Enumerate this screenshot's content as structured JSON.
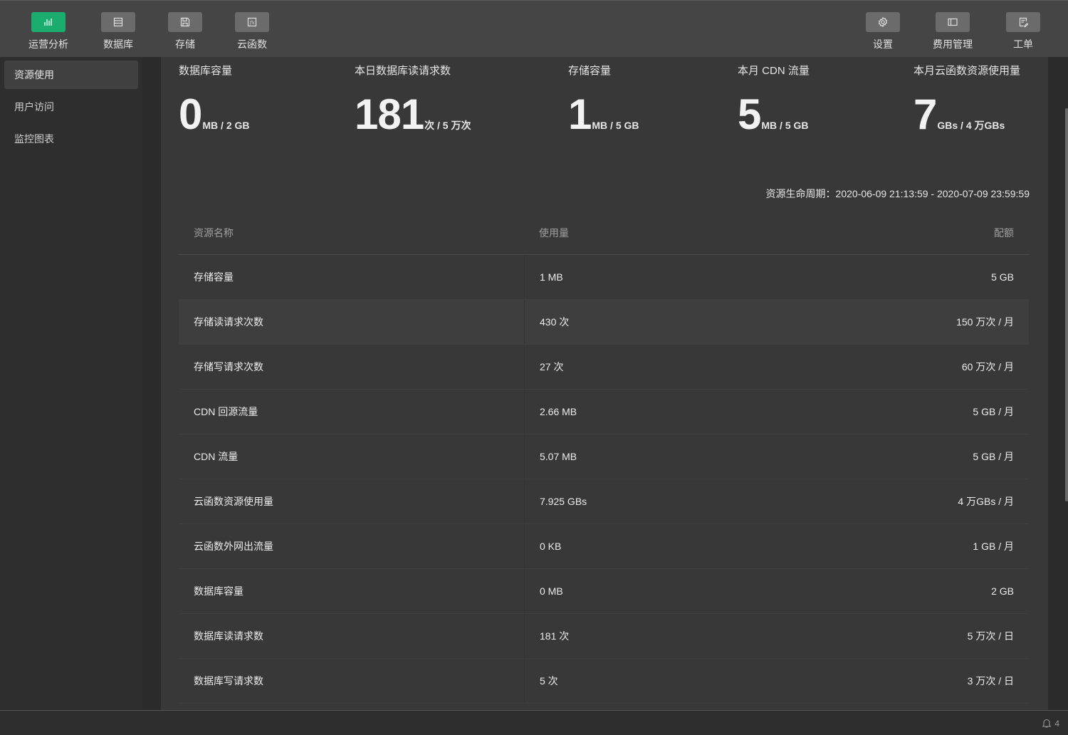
{
  "toolbar": {
    "left": [
      {
        "label": "运营分析",
        "icon": "chart-bars-icon",
        "active": true
      },
      {
        "label": "数据库",
        "icon": "database-icon",
        "active": false
      },
      {
        "label": "存储",
        "icon": "floppy-disk-icon",
        "active": false
      },
      {
        "label": "云函数",
        "icon": "function-fx-icon",
        "active": false
      }
    ],
    "right": [
      {
        "label": "设置",
        "icon": "gear-icon"
      },
      {
        "label": "费用管理",
        "icon": "billing-card-icon"
      },
      {
        "label": "工单",
        "icon": "ticket-edit-icon"
      }
    ],
    "active_color": "#1aad6d"
  },
  "sidebar": {
    "items": [
      {
        "label": "资源使用",
        "active": true
      },
      {
        "label": "用户访问",
        "active": false
      },
      {
        "label": "监控图表",
        "active": false
      }
    ]
  },
  "stats": [
    {
      "title": "数据库容量",
      "value": "0",
      "unit": "MB / 2 GB"
    },
    {
      "title": "本日数据库读请求数",
      "value": "181",
      "unit": "次 / 5 万次"
    },
    {
      "title": "存储容量",
      "value": "1",
      "unit": "MB / 5 GB"
    },
    {
      "title": "本月 CDN 流量",
      "value": "5",
      "unit": "MB / 5 GB"
    },
    {
      "title": "本月云函数资源使用量",
      "value": "7",
      "unit": "GBs / 4 万GBs"
    }
  ],
  "lifecycle": "资源生命周期：2020-06-09 21:13:59 - 2020-07-09 23:59:59",
  "table": {
    "headers": [
      "资源名称",
      "使用量",
      "配额"
    ],
    "rows": [
      [
        "存储容量",
        "1 MB",
        "5 GB"
      ],
      [
        "存储读请求次数",
        "430 次",
        "150 万次 / 月"
      ],
      [
        "存储写请求次数",
        "27 次",
        "60 万次 / 月"
      ],
      [
        "CDN 回源流量",
        "2.66 MB",
        "5 GB / 月"
      ],
      [
        "CDN 流量",
        "5.07 MB",
        "5 GB / 月"
      ],
      [
        "云函数资源使用量",
        "7.925 GBs",
        "4 万GBs / 月"
      ],
      [
        "云函数外网出流量",
        "0 KB",
        "1 GB / 月"
      ],
      [
        "数据库容量",
        "0 MB",
        "2 GB"
      ],
      [
        "数据库读请求数",
        "181 次",
        "5 万次 / 日"
      ],
      [
        "数据库写请求数",
        "5 次",
        "3 万次 / 日"
      ]
    ]
  },
  "statusbar": {
    "notifications": "4"
  }
}
